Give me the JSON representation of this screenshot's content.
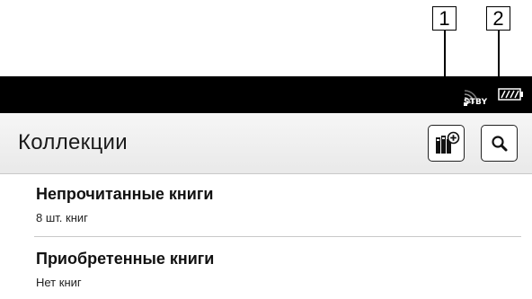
{
  "callouts": [
    "1",
    "2"
  ],
  "status_bar": {
    "standby_label": "STBY"
  },
  "header": {
    "title": "Коллекции",
    "add_collection_icon": "add-collection-icon",
    "search_icon": "search-icon"
  },
  "collections": [
    {
      "title": "Непрочитанные книги",
      "subtitle": "8 шт. книг"
    },
    {
      "title": "Приобретенные книги",
      "subtitle": "Нет книг"
    }
  ]
}
